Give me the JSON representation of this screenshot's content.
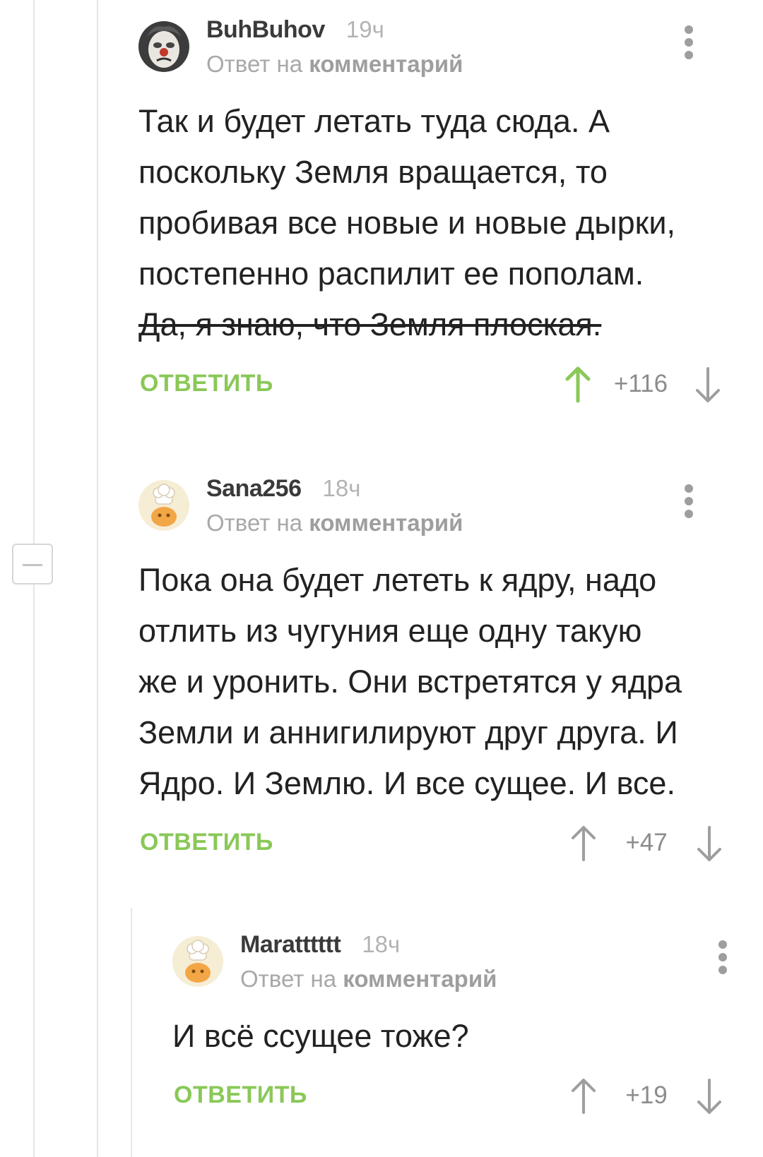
{
  "comments": [
    {
      "username": "BuhBuhov",
      "time": "19ч",
      "reply_prefix": "Ответ на",
      "reply_link": "комментарий",
      "lines": [
        "Так и будет летать туда сюда. А",
        "поскольку Земля вращается, то",
        "пробивая все новые и новые дырки,",
        "постепенно распилит ее пополам."
      ],
      "struck_line": "Да, я знаю, что Земля плоская.",
      "reply_label": "ОТВЕТИТЬ",
      "score": "+116",
      "upvoted": true
    },
    {
      "username": "Sana256",
      "time": "18ч",
      "reply_prefix": "Ответ на",
      "reply_link": "комментарий",
      "lines": [
        "Пока она будет лететь к ядру, надо",
        "отлить из чугуния еще одну такую",
        "же и уронить. Они встретятся у ядра",
        "Земли и аннигилируют друг друга. И",
        "Ядро. И Землю. И все сущее. И все."
      ],
      "reply_label": "ОТВЕТИТЬ",
      "score": "+47",
      "upvoted": false
    },
    {
      "username": "Maratttttt",
      "time": "18ч",
      "reply_prefix": "Ответ на",
      "reply_link": "комментарий",
      "lines": [
        "И всё ссущее тоже?"
      ],
      "reply_label": "ОТВЕТИТЬ",
      "score": "+19",
      "upvoted": false
    }
  ],
  "colors": {
    "accent_green": "#8ac858",
    "upvote_active": "#8ac858",
    "vote_inactive": "#9e9e9e"
  },
  "icons": [
    "clown-avatar-icon",
    "chef-avatar-icon",
    "kebab-menu-icon",
    "upvote-arrow-icon",
    "downvote-arrow-icon",
    "collapse-thread-icon"
  ]
}
